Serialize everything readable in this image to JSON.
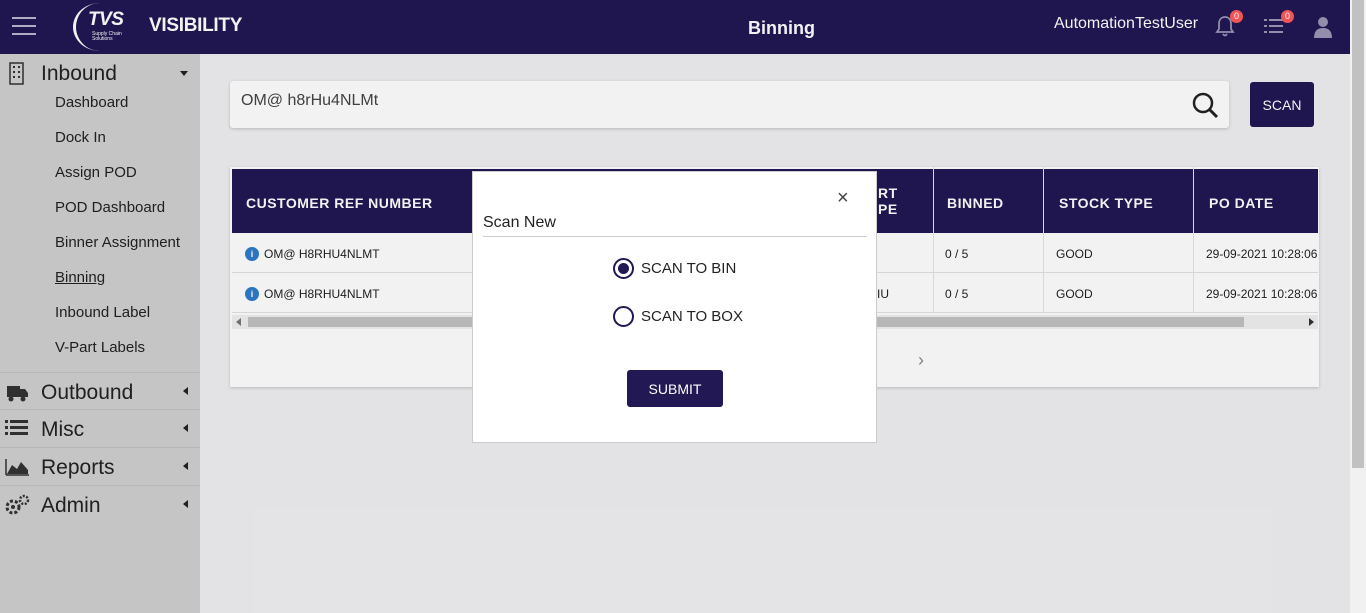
{
  "header": {
    "logo_text": "TVS",
    "logo_subtext": "Supply Chain Solutions",
    "brand": "VISIBILITY",
    "page_title": "Binning",
    "username": "AutomationTestUser",
    "notifications_count": "0",
    "tasks_count": "0"
  },
  "sidebar": {
    "inbound": {
      "label": "Inbound",
      "items": [
        "Dashboard",
        "Dock In",
        "Assign POD",
        "POD Dashboard",
        "Binner Assignment",
        "Binning",
        "Inbound Label",
        "V-Part Labels"
      ],
      "active": "Binning"
    },
    "outbound": "Outbound",
    "misc": "Misc",
    "reports": "Reports",
    "admin": "Admin"
  },
  "search": {
    "value": "OM@ h8rHu4NLMt",
    "scan_label": "SCAN"
  },
  "table": {
    "headers": [
      "CUSTOMER REF NUMBER",
      "RT",
      "PE",
      "BINNED",
      "STOCK TYPE",
      "PO DATE"
    ],
    "rows": [
      {
        "ref": "OM@ H8RHU4NLMT",
        "part": "",
        "binned": "0 / 5",
        "stock": "GOOD",
        "date": "29-09-2021 10:28:06"
      },
      {
        "ref": "OM@ H8RHU4NLMT",
        "part": "IU",
        "binned": "0 / 5",
        "stock": "GOOD",
        "date": "29-09-2021 10:28:06"
      }
    ]
  },
  "modal": {
    "close": "×",
    "title": "Scan New",
    "options": [
      "SCAN TO BIN",
      "SCAN TO BOX"
    ],
    "selected": "SCAN TO BIN",
    "submit_label": "SUBMIT"
  },
  "colors": {
    "primary": "#211854",
    "badge": "#ff5a5a",
    "info": "#2f7bc9"
  }
}
